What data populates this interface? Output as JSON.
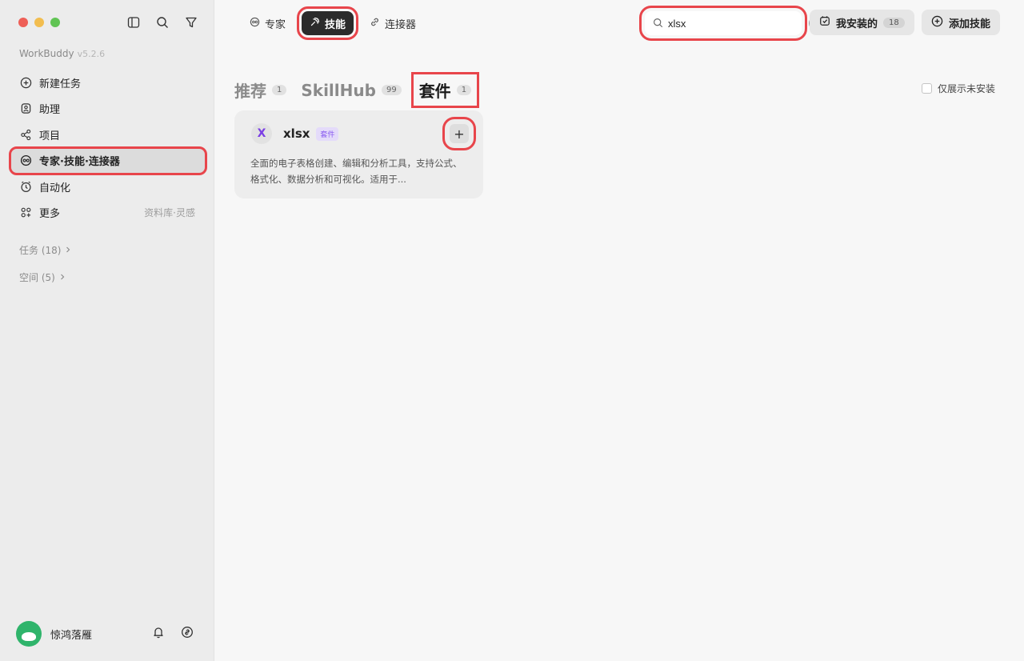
{
  "app": {
    "name": "WorkBuddy",
    "version": "v5.2.6"
  },
  "sidebar": {
    "items": [
      {
        "label": "新建任务",
        "icon": "plus-circle-icon"
      },
      {
        "label": "助理",
        "icon": "assistant-icon"
      },
      {
        "label": "项目",
        "icon": "project-icon"
      },
      {
        "label": "专家·技能·连接器",
        "icon": "expert-icon",
        "active": true
      },
      {
        "label": "自动化",
        "icon": "clock-icon"
      },
      {
        "label": "更多",
        "icon": "grid-icon",
        "hint": "资料库·灵感"
      }
    ],
    "sections": [
      {
        "label": "任务 (18)"
      },
      {
        "label": "空间 (5)"
      }
    ],
    "user": {
      "name": "惊鸿落雁"
    }
  },
  "topnav": {
    "tabs": [
      {
        "label": "专家",
        "icon": "expert-icon"
      },
      {
        "label": "技能",
        "icon": "skill-icon",
        "active": true
      },
      {
        "label": "连接器",
        "icon": "link-icon"
      }
    ],
    "search": {
      "value": "xlsx",
      "placeholder": ""
    },
    "installed": {
      "label": "我安装的",
      "count": "18"
    },
    "add_skill": {
      "label": "添加技能"
    }
  },
  "categories": [
    {
      "label": "推荐",
      "count": "1"
    },
    {
      "label": "SkillHub",
      "count": "99"
    },
    {
      "label": "套件",
      "count": "1",
      "active": true
    }
  ],
  "filter": {
    "label": "仅展示未安装"
  },
  "cards": [
    {
      "logo_letter": "X",
      "name": "xlsx",
      "tag": "套件",
      "add_label": "+",
      "description": "全面的电子表格创建、编辑和分析工具，支持公式、格式化、数据分析和可视化。适用于..."
    }
  ],
  "colors": {
    "highlight": "#e8454b",
    "accent_purple": "#7b3fe4",
    "active_tab": "#2b2b2b"
  }
}
